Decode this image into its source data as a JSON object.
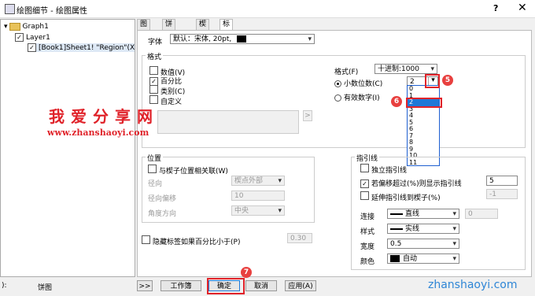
{
  "window": {
    "title": "绘图细节 - 绘图属性",
    "help": "?",
    "close": "✕"
  },
  "tree": {
    "graph": "Graph1",
    "layer": "Layer1",
    "plot": "[Book1]Sheet1! \"Region\"(X"
  },
  "tabs": [
    "图案",
    "饼图构型",
    "楔子",
    "标签"
  ],
  "font": {
    "label": "字体",
    "value": "默认：宋体, 20pt,"
  },
  "format": {
    "group": "格式",
    "checks": [
      "数值(V)",
      "百分比",
      "类别(C)",
      "自定义"
    ],
    "format_label": "格式(F)",
    "format_value": "十进制:1000",
    "decimal_label": "小数位数(C)",
    "decimal_value": "2",
    "sigfig_label": "有效数字(I)",
    "list": [
      "0",
      "1",
      "2",
      "3",
      "4",
      "5",
      "6",
      "7",
      "8",
      "9",
      "10",
      "11"
    ],
    "arrow": ">"
  },
  "position": {
    "group": "位置",
    "link_label": "与楔子位置相关联(W)",
    "radial_label": "径向",
    "radial_value": "楔点外部",
    "offset_label": "径向偏移",
    "offset_value": "10",
    "angle_label": "角度方向",
    "angle_value": "中央"
  },
  "hide": {
    "label": "隐藏标签如果百分比小于(P)",
    "value": "0.30"
  },
  "leader": {
    "group": "指引线",
    "independent": "独立指引线",
    "show_if": "若偏移超过(%)则显示指引线",
    "show_if_value": "5",
    "extend": "延伸指引线到楔子(%)",
    "extend_value": "-1",
    "connect_label": "连接",
    "connect_value": "直线",
    "connect_num": "0",
    "style_label": "样式",
    "style_value": "实线",
    "width_label": "宽度",
    "width_value": "0.5",
    "color_label": "颜色",
    "color_value": "自动"
  },
  "badges": {
    "b5": "5",
    "b6": "6",
    "b7": "7"
  },
  "watermark": {
    "cn": "我爱分享网",
    "url": "www.zhanshaoyi.com",
    "url2": "zhanshaoyi.com"
  },
  "status": {
    "left": "):",
    "pie": "饼图"
  },
  "buttons": {
    "more": ">>",
    "workbook": "工作簿",
    "ok": "确定",
    "cancel": "取消",
    "apply": "应用(A)"
  },
  "colors": {
    "accent": "#e0232a",
    "select": "#1e78d7"
  }
}
